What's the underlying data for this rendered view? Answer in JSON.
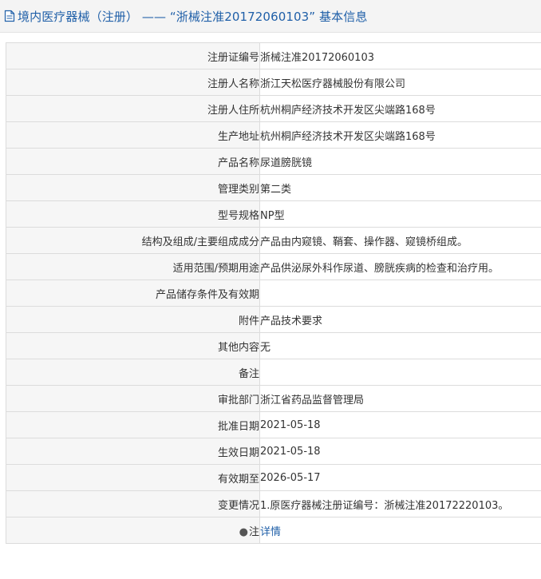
{
  "header": {
    "title": "境内医疗器械（注册） —— “浙械注准20172060103” 基本信息"
  },
  "rows": [
    {
      "label": "注册证编号",
      "value": "浙械注准20172060103"
    },
    {
      "label": "注册人名称",
      "value": "浙江天松医疗器械股份有限公司"
    },
    {
      "label": "注册人住所",
      "value": "杭州桐庐经济技术开发区尖端路168号"
    },
    {
      "label": "生产地址",
      "value": "杭州桐庐经济技术开发区尖端路168号"
    },
    {
      "label": "产品名称",
      "value": "尿道膀胱镜"
    },
    {
      "label": "管理类别",
      "value": "第二类"
    },
    {
      "label": "型号规格",
      "value": "NP型"
    },
    {
      "label": "结构及组成/主要组成成分",
      "value": "产品由内窥镜、鞘套、操作器、窥镜桥组成。"
    },
    {
      "label": "适用范围/预期用途",
      "value": "产品供泌尿外科作尿道、膀胱疾病的检查和治疗用。"
    },
    {
      "label": "产品储存条件及有效期",
      "value": ""
    },
    {
      "label": "附件",
      "value": "产品技术要求"
    },
    {
      "label": "其他内容",
      "value": "无"
    },
    {
      "label": "备注",
      "value": ""
    },
    {
      "label": "审批部门",
      "value": "浙江省药品监督管理局"
    },
    {
      "label": "批准日期",
      "value": "2021-05-18"
    },
    {
      "label": "生效日期",
      "value": "2021-05-18"
    },
    {
      "label": "有效期至",
      "value": "2026-05-17"
    },
    {
      "label": "变更情况",
      "value": "1.原医疗器械注册证编号：浙械注准20172220103。"
    }
  ],
  "note_row": {
    "icon": "lightbulb-icon",
    "label": "注",
    "link_text": "详情"
  },
  "colors": {
    "title": "#1f5fa8",
    "link": "#1f5fa8",
    "label_bg": "#f6f6f6",
    "border": "#dcdcdc",
    "header_bg": "#f4f4f4"
  }
}
